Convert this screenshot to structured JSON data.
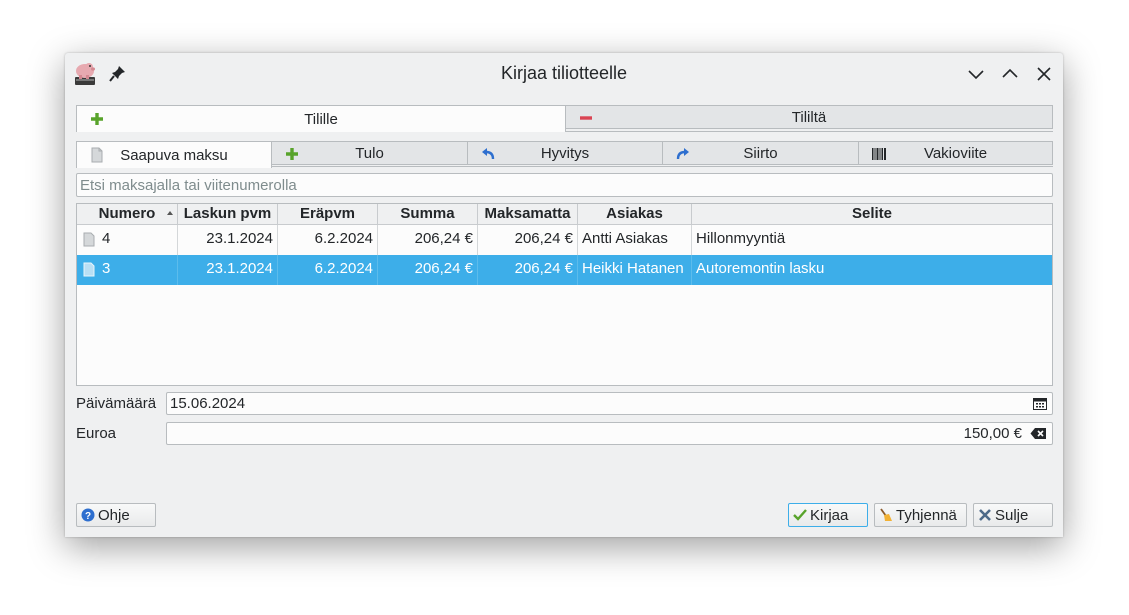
{
  "window": {
    "title": "Kirjaa tiliotteelle"
  },
  "direction_tabs": [
    {
      "label": "Tilille",
      "icon": "plus-icon",
      "active": true
    },
    {
      "label": "Tililtä",
      "icon": "minus-icon",
      "active": false
    }
  ],
  "type_tabs": [
    {
      "label": "Saapuva maksu",
      "icon": "document-icon",
      "active": true
    },
    {
      "label": "Tulo",
      "icon": "plus-icon",
      "active": false
    },
    {
      "label": "Hyvitys",
      "icon": "undo-arrow-icon",
      "active": false
    },
    {
      "label": "Siirto",
      "icon": "redo-arrow-icon",
      "active": false
    },
    {
      "label": "Vakioviite",
      "icon": "barcode-icon",
      "active": false
    }
  ],
  "search": {
    "placeholder": "Etsi maksajalla tai viitenumerolla",
    "value": ""
  },
  "table": {
    "columns": [
      "Numero",
      "Laskun pvm",
      "Eräpvm",
      "Summa",
      "Maksamatta",
      "Asiakas",
      "Selite"
    ],
    "sorted_column": "Numero",
    "rows": [
      {
        "numero": "4",
        "laskun_pvm": "23.1.2024",
        "erapvm": "6.2.2024",
        "summa": "206,24 €",
        "maksamatta": "206,24 €",
        "asiakas": "Antti Asiakas",
        "selite": "Hillonmyyntiä",
        "selected": false
      },
      {
        "numero": "3",
        "laskun_pvm": "23.1.2024",
        "erapvm": "6.2.2024",
        "summa": "206,24 €",
        "maksamatta": "206,24 €",
        "asiakas": "Heikki Hatanen",
        "selite": "Autoremontin lasku",
        "selected": true
      }
    ]
  },
  "form": {
    "date_label": "Päivämäärä",
    "date_value": "15.06.2024",
    "amount_label": "Euroa",
    "amount_value": "150,00 €"
  },
  "buttons": {
    "help": "Ohje",
    "post": "Kirjaa",
    "clear": "Tyhjennä",
    "close": "Sulje"
  },
  "colors": {
    "selection": "#3daee9",
    "plus": "#58a32b",
    "minus": "#da4453",
    "help": "#2e6fcf"
  }
}
